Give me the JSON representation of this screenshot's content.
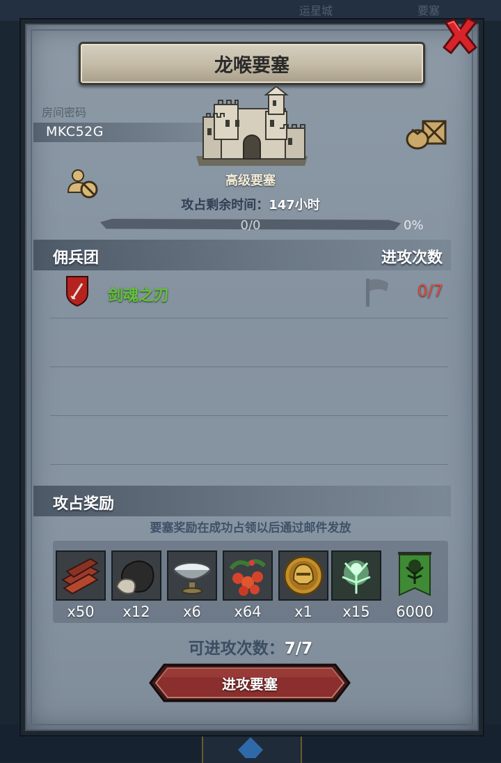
{
  "background": {
    "ghost_tabs": [
      "运星城",
      "要塞"
    ]
  },
  "header": {
    "title": "龙喉要塞",
    "close_icon": "close-x-icon"
  },
  "room": {
    "code_label": "房间密码",
    "code_value": "MKC52G"
  },
  "fortress": {
    "level_label": "高级要塞",
    "time_label": "攻占剩余时间：",
    "time_value": "147小时",
    "progress_text": "0/0",
    "progress_percent": "0%",
    "progress_fraction": 0
  },
  "mercenaries": {
    "header": "佣兵团",
    "attack_count_header": "进攻次数",
    "rows": [
      {
        "name": "剑魂之刃",
        "attacks": "0/7"
      }
    ]
  },
  "rewards": {
    "header": "攻占奖励",
    "note": "要塞奖励在成功占领以后通过邮件发放",
    "items": [
      {
        "icon": "wood-planks-icon",
        "count": "x50"
      },
      {
        "icon": "truffle-stone-icon",
        "count": "x12"
      },
      {
        "icon": "silver-bowl-icon",
        "count": "x6"
      },
      {
        "icon": "berries-icon",
        "count": "x64"
      },
      {
        "icon": "golden-helmet-coin-icon",
        "count": "x1"
      },
      {
        "icon": "green-spirit-icon",
        "count": "x15"
      },
      {
        "icon": "guild-banner-icon",
        "count": "6000"
      }
    ]
  },
  "footer": {
    "attempts_label": "可进攻次数：",
    "attempts_value": "7/7",
    "attack_button": "进攻要塞"
  },
  "colors": {
    "panel": "#8592a0",
    "merc_name": "#63c13c",
    "attack_count": "#e04a3c",
    "button": "#8a2f2d"
  }
}
